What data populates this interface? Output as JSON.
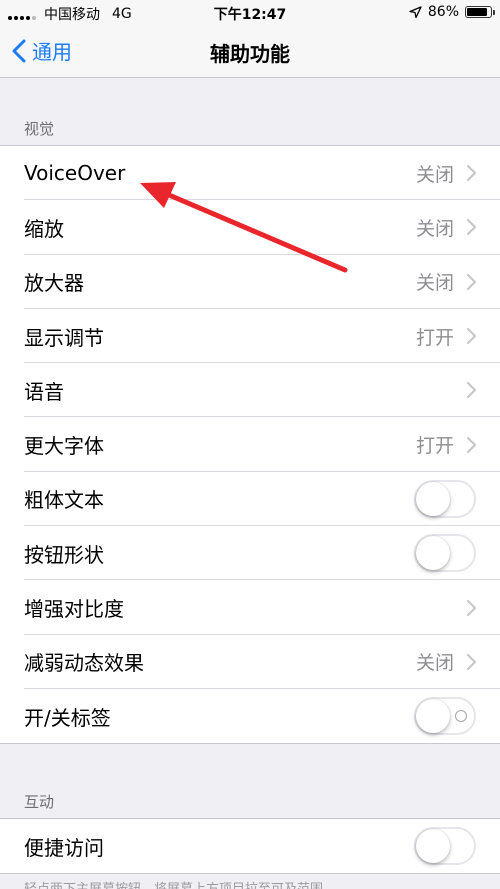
{
  "status_bar": {
    "carrier": "中国移动",
    "network": "4G",
    "time": "下午12:47",
    "battery_percent": "86%",
    "battery_level": 0.86
  },
  "nav": {
    "back_label": "通用",
    "title": "辅助功能"
  },
  "sections": {
    "vision_header": "视觉",
    "interaction_header": "互动"
  },
  "vision_rows": [
    {
      "label": "VoiceOver",
      "value": "关闭",
      "accessory": "chevron"
    },
    {
      "label": "缩放",
      "value": "关闭",
      "accessory": "chevron"
    },
    {
      "label": "放大器",
      "value": "关闭",
      "accessory": "chevron"
    },
    {
      "label": "显示调节",
      "value": "打开",
      "accessory": "chevron"
    },
    {
      "label": "语音",
      "value": "",
      "accessory": "chevron"
    },
    {
      "label": "更大字体",
      "value": "打开",
      "accessory": "chevron"
    },
    {
      "label": "粗体文本",
      "value": "",
      "accessory": "toggle-off"
    },
    {
      "label": "按钮形状",
      "value": "",
      "accessory": "toggle-off"
    },
    {
      "label": "增强对比度",
      "value": "",
      "accessory": "chevron"
    },
    {
      "label": "减弱动态效果",
      "value": "关闭",
      "accessory": "chevron"
    },
    {
      "label": "开/关标签",
      "value": "",
      "accessory": "toggle-off-label"
    }
  ],
  "interaction_rows": [
    {
      "label": "便捷访问",
      "value": "",
      "accessory": "toggle-off"
    }
  ],
  "footer": "轻点两下主屏幕按钮，将屏幕上方项目拉至可及范围。",
  "colors": {
    "accent": "#1a7cf4",
    "background": "#efeff4",
    "annotation": "#e8262b"
  },
  "icons": {
    "back": "chevron-left-icon",
    "row_accessory": "chevron-right-icon",
    "location": "location-arrow-icon",
    "battery": "battery-icon"
  }
}
